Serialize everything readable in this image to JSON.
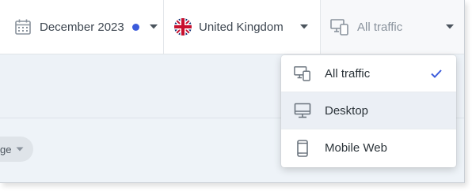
{
  "filters": {
    "date": {
      "label": "December 2023",
      "status_color": "#3b5bdb"
    },
    "country": {
      "label": "United Kingdom",
      "flag": "uk-flag-icon"
    },
    "traffic": {
      "label": "All traffic"
    }
  },
  "traffic_menu": {
    "selected": "All traffic",
    "items": [
      {
        "label": "All traffic",
        "icon": "devices-icon",
        "checked": true
      },
      {
        "label": "Desktop",
        "icon": "desktop-icon",
        "checked": false
      },
      {
        "label": "Mobile Web",
        "icon": "mobile-icon",
        "checked": false
      }
    ]
  },
  "chip": {
    "label": "ge"
  },
  "colors": {
    "accent": "#3b5bdb",
    "check": "#3b5bdb"
  }
}
